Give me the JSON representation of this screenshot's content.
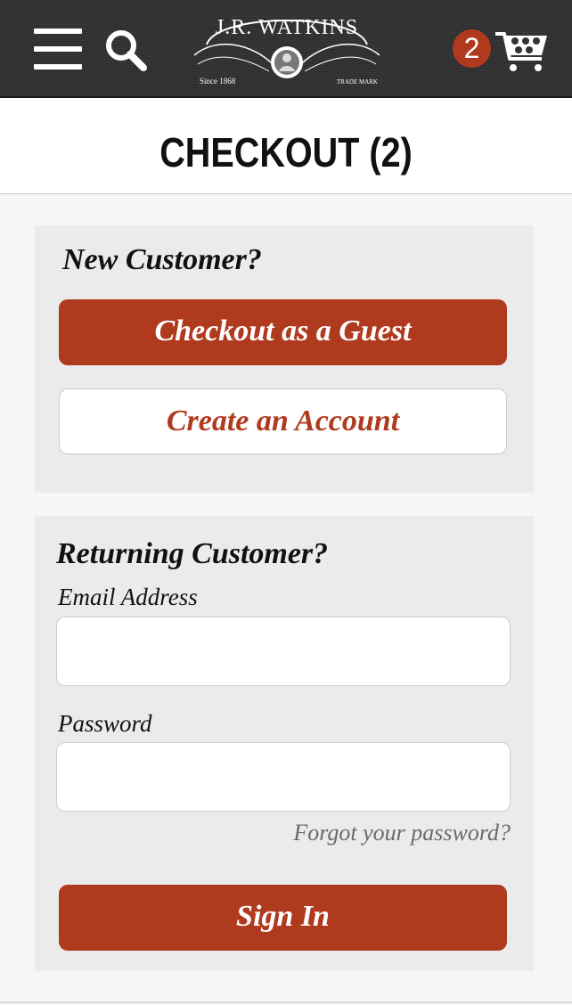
{
  "header": {
    "menu_icon": "hamburger-menu-icon",
    "search_icon": "search-icon",
    "logo": {
      "name": "J.R. WATKINS",
      "since": "Since 1868",
      "trademark": "TRADE MARK"
    },
    "cart": {
      "count": "2",
      "icon": "shopping-cart-icon"
    }
  },
  "page": {
    "title": "CHECKOUT (2)"
  },
  "new_customer": {
    "heading": "New Customer?",
    "guest_button": "Checkout as a Guest",
    "create_account_button": "Create an Account"
  },
  "returning_customer": {
    "heading": "Returning Customer?",
    "email_label": "Email Address",
    "email_value": "",
    "password_label": "Password",
    "password_value": "",
    "forgot_link": "Forgot your password?",
    "sign_in_button": "Sign In"
  },
  "colors": {
    "brand_red": "#b03a1e",
    "header_dark": "#333333",
    "panel_gray": "#ebebeb"
  }
}
